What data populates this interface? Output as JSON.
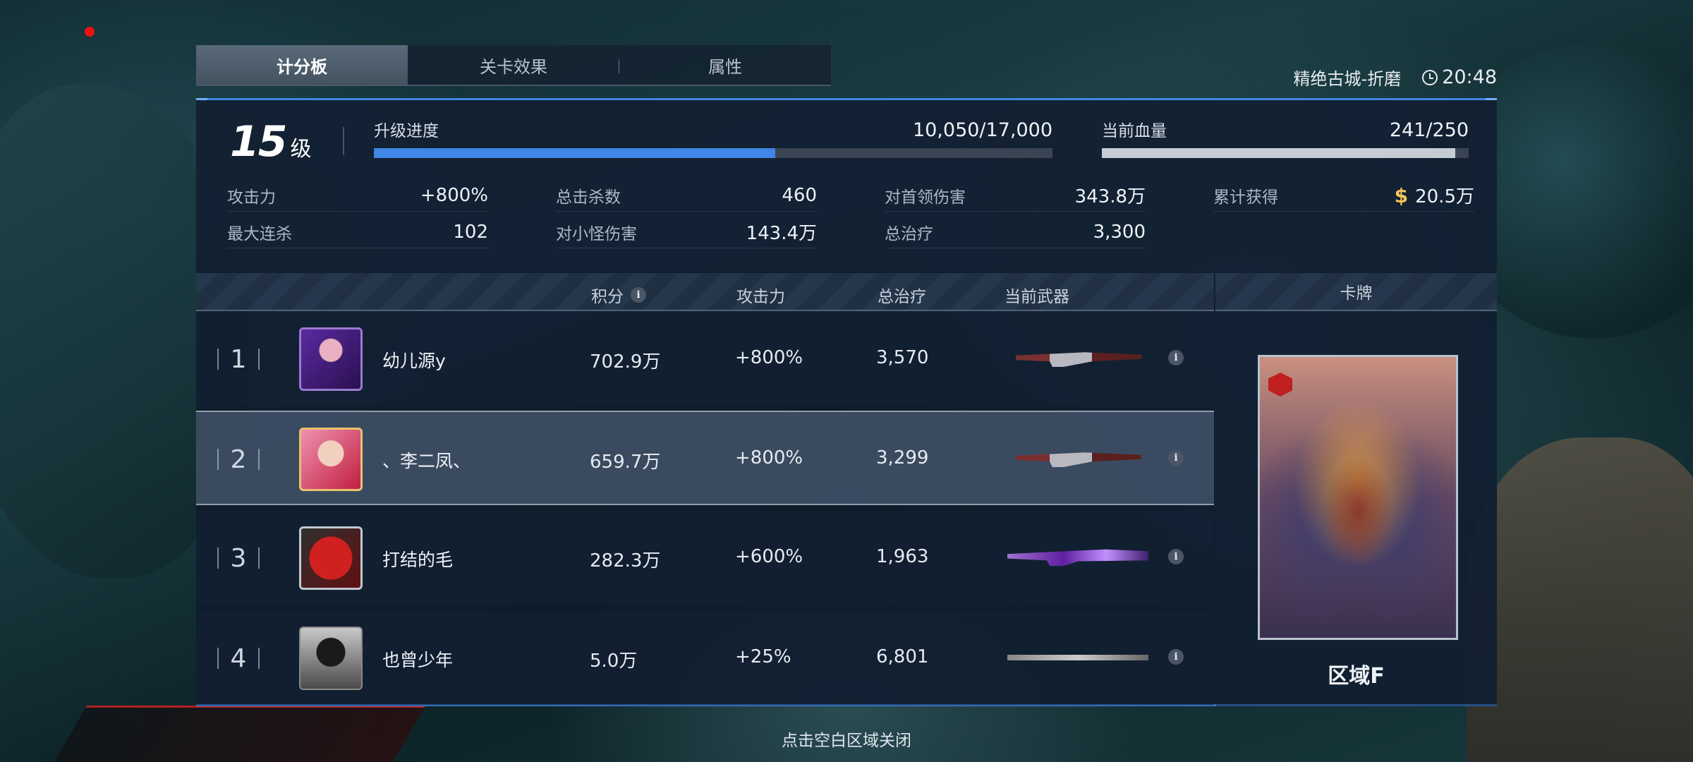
{
  "tabs": [
    {
      "label": "计分板",
      "active": true
    },
    {
      "label": "关卡效果",
      "active": false
    },
    {
      "label": "属性",
      "active": false
    }
  ],
  "map": {
    "name": "精绝古城-折磨",
    "time": "20:48"
  },
  "level": {
    "number": "15",
    "unit": "级"
  },
  "exp_bar": {
    "label": "升级进度",
    "value": "10,050/17,000",
    "progress": 0.591,
    "color": "#3f86e6"
  },
  "hp_bar": {
    "label": "当前血量",
    "value": "241/250",
    "progress": 0.964,
    "color": "#c5ccd3"
  },
  "stats": [
    {
      "label": "攻击力",
      "value": "+800%"
    },
    {
      "label": "总击杀数",
      "value": "460"
    },
    {
      "label": "对首领伤害",
      "value": "343.8万"
    },
    {
      "label": "累计获得",
      "value": "20.5万",
      "coin_icon": "$"
    },
    {
      "label": "最大连杀",
      "value": "102"
    },
    {
      "label": "对小怪伤害",
      "value": "143.4万"
    },
    {
      "label": "总治疗",
      "value": "3,300"
    }
  ],
  "table": {
    "headers": {
      "score": "积分",
      "attack": "攻击力",
      "healing": "总治疗",
      "weapon": "当前武器"
    },
    "info_glyph": "i",
    "rows": [
      {
        "rank": "1",
        "name": "幼儿源y",
        "score": "702.9万",
        "attack": "+800%",
        "healing": "3,570",
        "weapon_icon": "red-sniper-rifle"
      },
      {
        "rank": "2",
        "name": "、李二凤、",
        "score": "659.7万",
        "attack": "+800%",
        "healing": "3,299",
        "weapon_icon": "red-sniper-rifle"
      },
      {
        "rank": "3",
        "name": "打结的毛",
        "score": "282.3万",
        "attack": "+600%",
        "healing": "1,963",
        "weapon_icon": "purple-sniper-rifle"
      },
      {
        "rank": "4",
        "name": "也曾少年",
        "score": "5.0万",
        "attack": "+25%",
        "healing": "6,801",
        "weapon_icon": "thin-spear-rifle"
      }
    ]
  },
  "card": {
    "header": "卡牌",
    "name": "区域F"
  },
  "close_hint": "点击空白区域关闭"
}
